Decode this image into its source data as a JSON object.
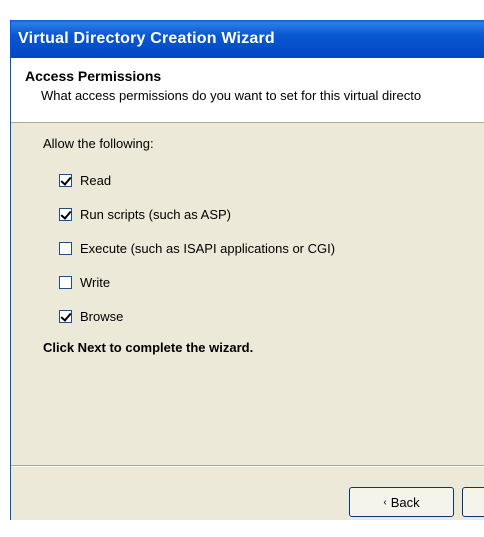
{
  "window": {
    "title": "Virtual Directory Creation Wizard"
  },
  "header": {
    "title": "Access Permissions",
    "subtitle": "What access permissions do you want to set for this virtual directo"
  },
  "main": {
    "allow_label": "Allow the following:",
    "options": [
      {
        "label": "Read",
        "checked": true
      },
      {
        "label": "Run scripts (such as ASP)",
        "checked": true
      },
      {
        "label": "Execute (such as ISAPI applications or CGI)",
        "checked": false
      },
      {
        "label": "Write",
        "checked": false
      },
      {
        "label": "Browse",
        "checked": true
      }
    ],
    "instruction": "Click Next to complete the wizard."
  },
  "footer": {
    "back_label": "Back",
    "back_icon": "chevron-left-icon"
  },
  "colors": {
    "titlebar": "#0054e3",
    "dialog_bg": "#ece9d8",
    "header_bg": "#ffffff"
  }
}
